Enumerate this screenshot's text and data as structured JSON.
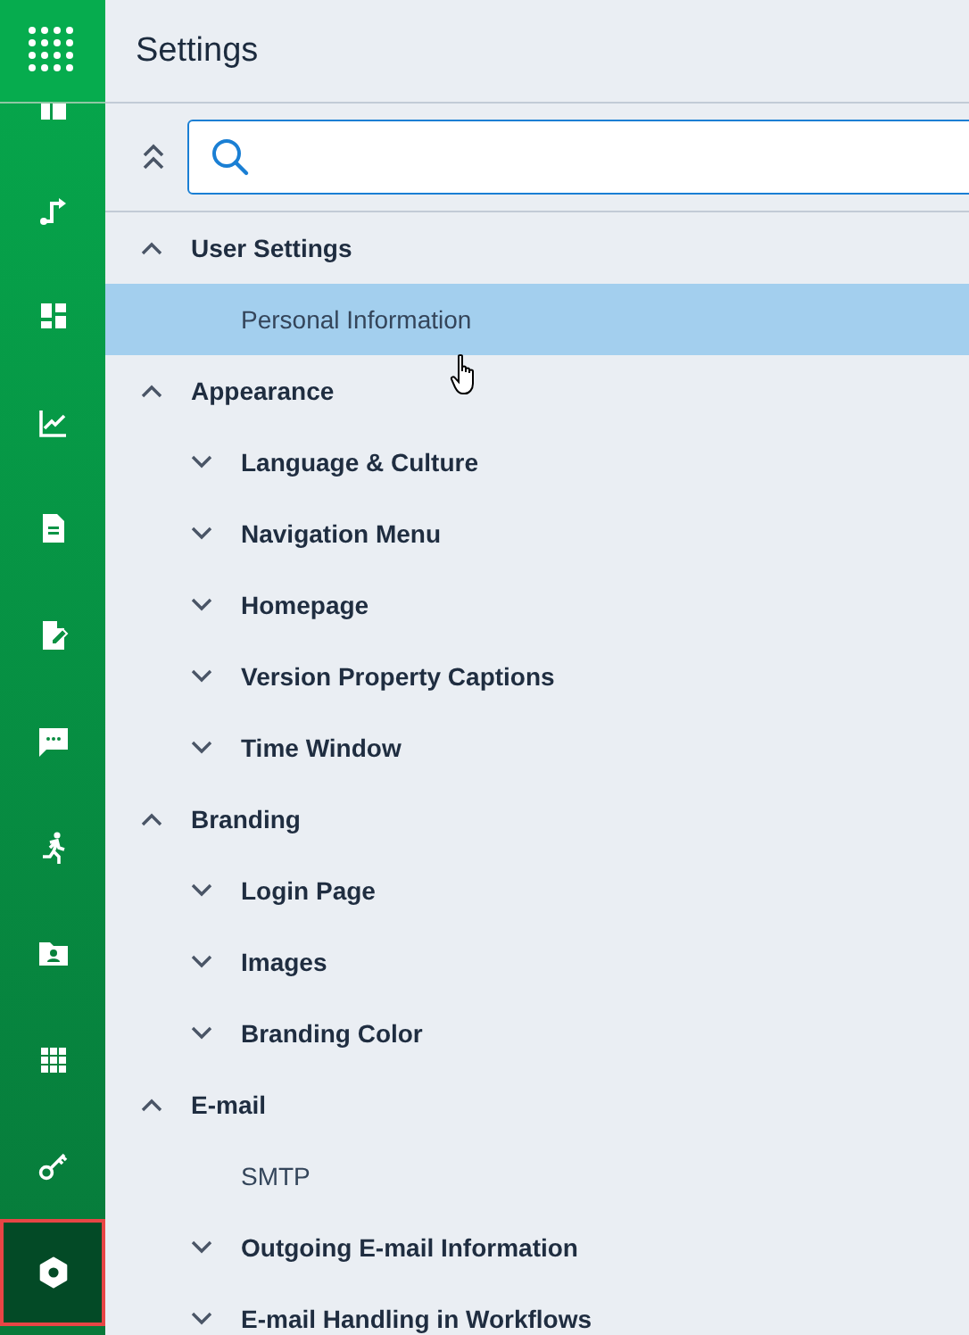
{
  "app_menu": {
    "kind": "launcher"
  },
  "sidebar": {
    "items": [
      {
        "selected": false
      },
      {
        "selected": false
      },
      {
        "selected": false
      },
      {
        "selected": false
      },
      {
        "selected": false
      },
      {
        "selected": false
      },
      {
        "selected": false
      },
      {
        "selected": false
      },
      {
        "selected": false
      },
      {
        "selected": false
      },
      {
        "selected": false
      },
      {
        "selected": true
      }
    ]
  },
  "header": {
    "title": "Settings"
  },
  "search": {
    "focused": true
  },
  "tree": [
    {
      "kind": "group",
      "label": "User Settings",
      "expanded": true,
      "selected": false,
      "children": [
        {
          "kind": "item",
          "label": "Personal Information",
          "selected": true
        }
      ]
    },
    {
      "kind": "group",
      "label": "Appearance",
      "expanded": true,
      "selected": false,
      "children": [
        {
          "kind": "group",
          "label": "Language & Culture",
          "expanded": false,
          "selected": false
        },
        {
          "kind": "group",
          "label": "Navigation Menu",
          "expanded": false,
          "selected": false
        },
        {
          "kind": "group",
          "label": "Homepage",
          "expanded": false,
          "selected": false
        },
        {
          "kind": "group",
          "label": "Version Property Captions",
          "expanded": false,
          "selected": false
        },
        {
          "kind": "group",
          "label": "Time Window",
          "expanded": false,
          "selected": false
        }
      ]
    },
    {
      "kind": "group",
      "label": "Branding",
      "expanded": true,
      "selected": false,
      "children": [
        {
          "kind": "group",
          "label": "Login Page",
          "expanded": false,
          "selected": false
        },
        {
          "kind": "group",
          "label": "Images",
          "expanded": false,
          "selected": false
        },
        {
          "kind": "group",
          "label": "Branding Color",
          "expanded": false,
          "selected": false
        }
      ]
    },
    {
      "kind": "group",
      "label": "E-mail",
      "expanded": true,
      "selected": false,
      "children": [
        {
          "kind": "item",
          "label": "SMTP",
          "selected": false
        },
        {
          "kind": "group",
          "label": "Outgoing E-mail Information",
          "expanded": false,
          "selected": false
        },
        {
          "kind": "group",
          "label": "E-mail Handling in Workflows",
          "expanded": false,
          "selected": false
        }
      ]
    }
  ]
}
